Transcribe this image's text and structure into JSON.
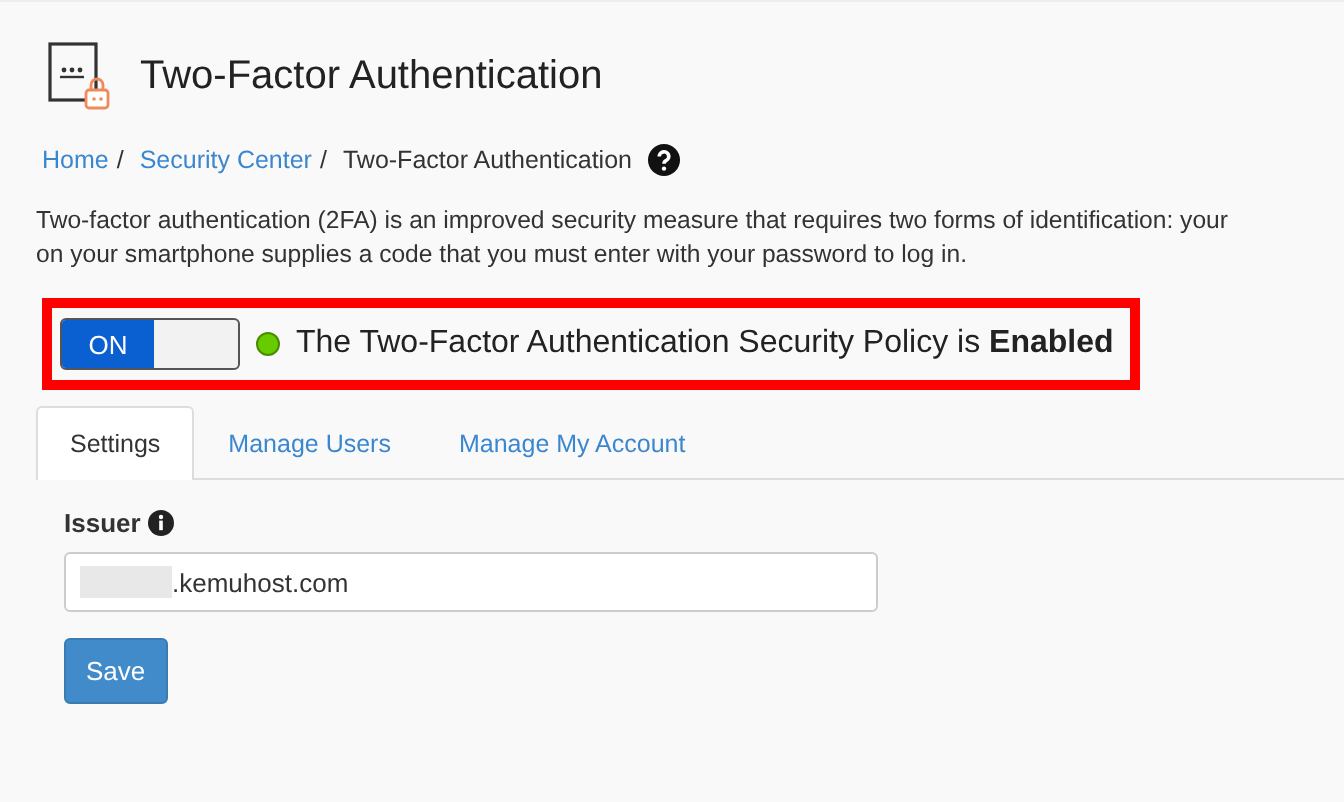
{
  "page": {
    "title": "Two-Factor Authentication"
  },
  "breadcrumb_separator": "/",
  "breadcrumb": [
    {
      "label": "Home",
      "link": true
    },
    {
      "label": "Security Center",
      "link": true
    },
    {
      "label": "Two-Factor Authentication",
      "link": false
    }
  ],
  "description": "Two-factor authentication (2FA) is an improved security measure that requires two forms of identification: your\non your smartphone supplies a code that you must enter with your password to log in.",
  "policy": {
    "toggle_label": "ON",
    "on": true,
    "status_text": "The Two-Factor Authentication Security Policy is **Enabled**"
  },
  "tabs": [
    {
      "label": "Settings",
      "selected": true
    },
    {
      "label": "Manage Users",
      "selected": false
    },
    {
      "label": "Manage My Account",
      "selected": false
    }
  ],
  "issuer": {
    "label": "Issuer",
    "value": ".kemuhost.com",
    "redacted": true
  },
  "buttons": [
    "Save"
  ]
}
